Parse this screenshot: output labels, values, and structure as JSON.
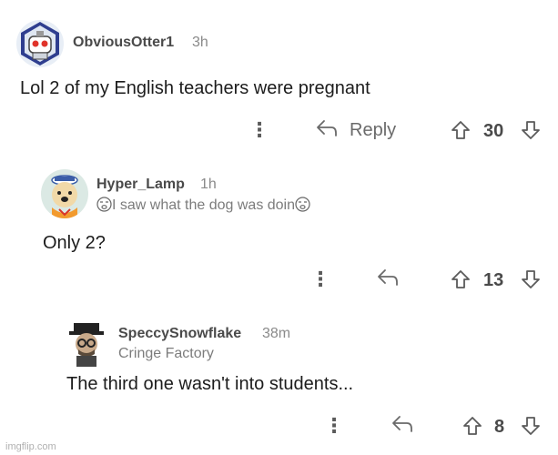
{
  "comments": [
    {
      "username": "ObviousOtter1",
      "time": "3h",
      "flair": "",
      "body": "Lol 2 of my English teachers were pregnant",
      "score": "30",
      "reply_label": "Reply",
      "avatar_icon": "otter-robot-avatar"
    },
    {
      "username": "Hyper_Lamp",
      "time": "1h",
      "flair": "I saw what the dog was doin",
      "flair_icon": "dizzy-face-emoji",
      "body": "Only 2?",
      "score": "13",
      "avatar_icon": "dog-sailor-avatar"
    },
    {
      "username": "SpeccySnowflake",
      "time": "38m",
      "flair": "Cringe Factory",
      "body": "The third one wasn't into students...",
      "score": "8",
      "avatar_icon": "hat-glasses-avatar"
    }
  ],
  "watermark": "imgflip.com",
  "colors": {
    "text": "#1c1c1c",
    "muted": "#8a8a8a",
    "icon": "#5a5a5a"
  }
}
